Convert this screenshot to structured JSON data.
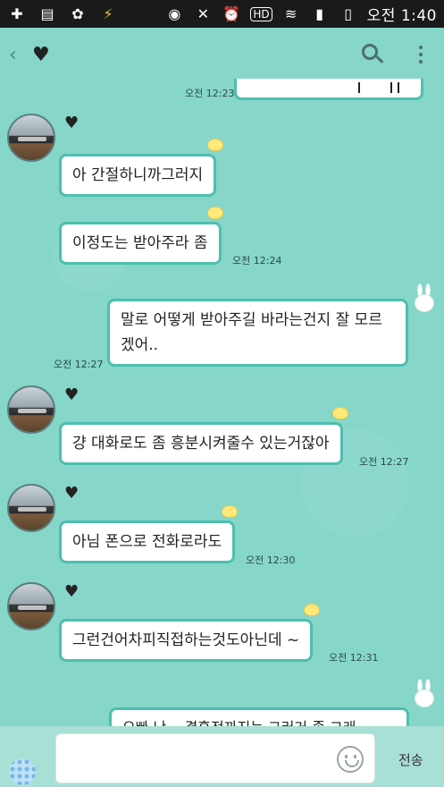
{
  "statusbar": {
    "ampm": "오전",
    "time": "1:40",
    "hd": "HD"
  },
  "header": {
    "back": "‹",
    "title_icon": "heart-icon"
  },
  "messages": [
    {
      "id": "m0",
      "time": "오전 12:23"
    },
    {
      "id": "m1",
      "text": "아 간절하니까그러지"
    },
    {
      "id": "m2",
      "text": "이정도는 받아주라 좀",
      "time": "오전 12:24"
    },
    {
      "id": "m3",
      "text": "말로 어떻게 받아주길 바라는건지 잘 모르겠어..",
      "time": "오전 12:27"
    },
    {
      "id": "m4",
      "text": "걍 대화로도 좀 흥분시켜줄수 있는거잖아",
      "time": "오전 12:27"
    },
    {
      "id": "m5",
      "text": "아님 폰으로 전화로라도",
      "time": "오전 12:30"
    },
    {
      "id": "m6",
      "text": "그런건어차피직접하는것도아닌데 ~",
      "time": "오전 12:31"
    },
    {
      "id": "m7",
      "text": "오빠 난 .. 결혼전까지는 그러거 좀 그래"
    }
  ],
  "input": {
    "send_label": "전송"
  },
  "colors": {
    "background": "#86d6ca",
    "bubble_border": "#4dbfae",
    "statusbar": "#1a1a1a"
  }
}
